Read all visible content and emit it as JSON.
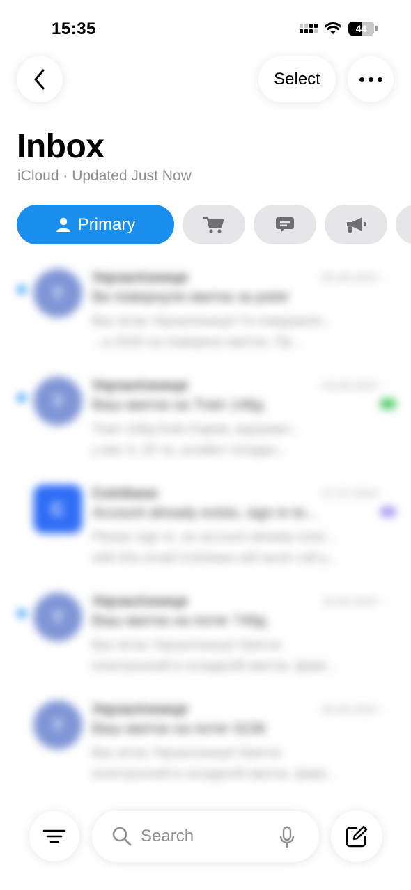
{
  "status_bar": {
    "time": "15:35",
    "battery": "44"
  },
  "nav": {
    "back_icon": "chevron-left-icon",
    "select_label": "Select",
    "more_icon": "ellipsis-icon"
  },
  "header": {
    "title": "Inbox",
    "subtitle": "iCloud · Updated Just Now"
  },
  "categories": [
    {
      "label": "Primary",
      "icon": "person-icon",
      "selected": true
    },
    {
      "icon": "cart-icon"
    },
    {
      "icon": "chat-bubble-icon"
    },
    {
      "icon": "megaphone-icon"
    },
    {
      "icon": "partially-visible-chip"
    }
  ],
  "messages": [
    {
      "unread": true,
      "avatar_letter": "Y",
      "sender": "Укрзалізниця",
      "date": "05.08.2024",
      "subject": "Ви повернули квиток за potяг",
      "preview": [
        "Вас вітає Укрзалізниця! Ги повідомля...",
        "...а 2020 на поверенн квитка. Пр..."
      ],
      "flag_color": ""
    },
    {
      "unread": true,
      "avatar_letter": "Y",
      "sender": "Укрзалізниця",
      "date": "03.08.2024",
      "subject": "Ваш квиток на Train 148д",
      "preview": [
        "Train 148д Київ-Харків, відправл...",
        "у вас 4, 20 та, шлайнт поїздки..."
      ],
      "flag_color": "#47c95e"
    },
    {
      "unread": false,
      "avatar_letter": "C",
      "sender": "Coinbase",
      "date": "27.07.2024",
      "subject": "Account already exists, sign in to...",
      "preview": [
        "Please sign in, an account already exist...",
        "with this email Coinbase will never call y..."
      ],
      "flag_color": "#a994f0"
    },
    {
      "unread": true,
      "avatar_letter": "Y",
      "sender": "Укрзалізниця",
      "date": "16.06.2024",
      "subject": "Ваш квиток на потяг 749д",
      "preview": [
        "Вас вітає Укрзалізниця! Квиток",
        "електронний в складеній квиток, фамі..."
      ],
      "flag_color": ""
    },
    {
      "unread": false,
      "avatar_letter": "Y",
      "sender": "Укрзалізниця",
      "date": "05.06.2024",
      "subject": "Ваш квиток на потяг 023К",
      "preview": [
        "Вас вітає Укрзалізниця! Квиток",
        "електронний в складеній квиток, фамі..."
      ],
      "flag_color": ""
    }
  ],
  "toolbar": {
    "filter_icon": "filter-lines-icon",
    "search_placeholder": "Search",
    "mic_icon": "microphone-icon",
    "compose_icon": "compose-icon"
  },
  "colors": {
    "accent": "#1a8ff0",
    "chip_bg": "#e6e6e9",
    "subtitle": "#8e8e93"
  }
}
